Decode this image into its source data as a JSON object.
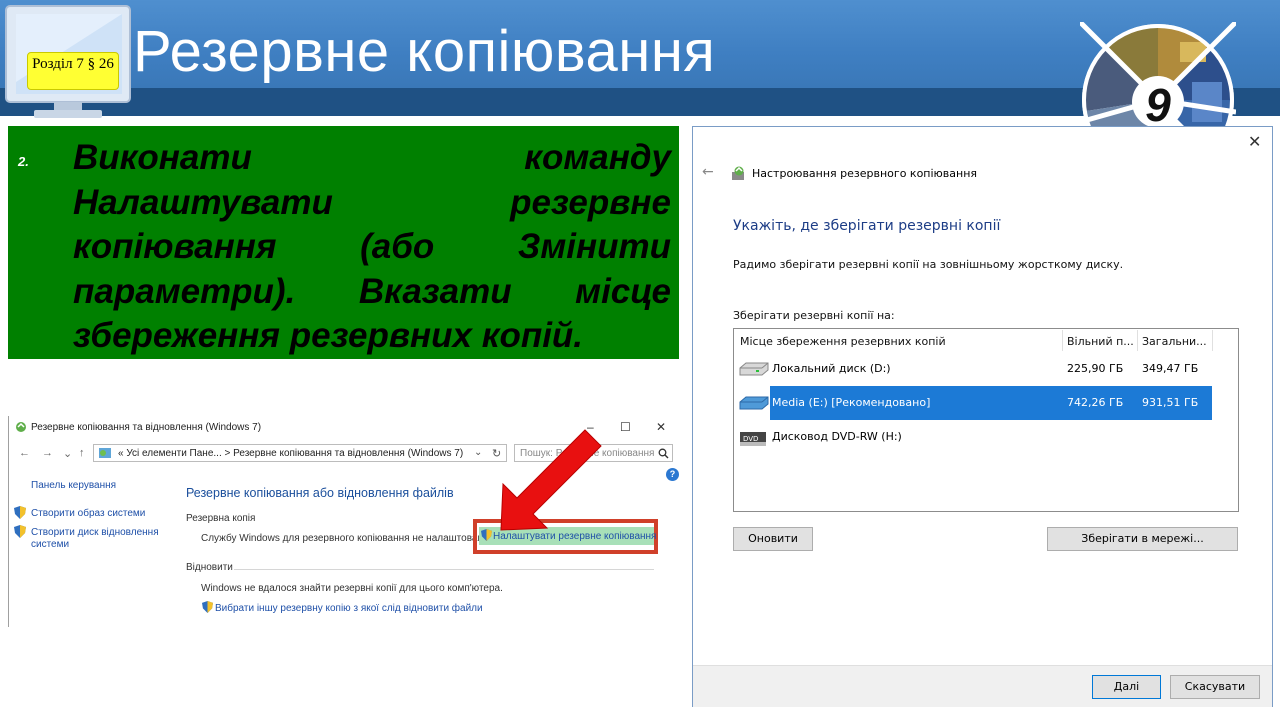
{
  "slide": {
    "badge": "Розділ 7 § 26",
    "title": "Резервне копіювання",
    "grade_number": "9",
    "step_number": "2.",
    "step_text": "Виконати команду Налаштувати резервне копіювання (або Змінити параметри). Вказати місце збереження резервних копій."
  },
  "control_panel": {
    "window_title": "Резервне копіювання та відновлення (Windows 7)",
    "window_buttons": [
      "–",
      "☐",
      "✕"
    ],
    "nav": [
      "←",
      "→",
      "⌄",
      "↑"
    ],
    "address_path": "«  Усі елементи Пане...  >  Резервне копіювання та відновлення (Windows 7)",
    "search_placeholder": "Пошук: Резервне копіювання",
    "help": "?",
    "sidebar": [
      {
        "label": "Панель керування"
      },
      {
        "label": "Створити образ системи"
      },
      {
        "label": "Створити диск відновлення системи"
      }
    ],
    "main_title": "Резервне копіювання або відновлення файлів",
    "backup_section": "Резервна копія",
    "backup_message": "Службу Windows для резервного копіювання не налаштовано.",
    "setup_link": "Налаштувати резервне копіювання",
    "restore_section": "Відновити",
    "restore_message": "Windows не вдалося знайти резервні копії для цього комп'ютера.",
    "restore_link": "Вибрати іншу резервну копію з якої слід відновити файли"
  },
  "dialog": {
    "close": "✕",
    "back": "←",
    "title": "Настроювання резервного копіювання",
    "heading": "Укажіть, де зберігати резервні копії",
    "description": "Радимо зберігати резервні копії на зовнішньому жорсткому диску.",
    "save_label": "Зберігати резервні копії на:",
    "columns": [
      "Місце збереження резервних копій",
      "Вільний п...",
      "Загальни..."
    ],
    "rows": [
      {
        "name": "Локальний диск (D:)",
        "free": "225,90 ГБ",
        "total": "349,47 ГБ",
        "selected": false,
        "icon": "hard-drive-icon"
      },
      {
        "name": "Media (E:) [Рекомендовано]",
        "free": "742,26 ГБ",
        "total": "931,51 ГБ",
        "selected": true,
        "icon": "external-drive-icon"
      },
      {
        "name": "Дисковод DVD-RW (H:)",
        "free": "",
        "total": "",
        "selected": false,
        "icon": "dvd-drive-icon"
      }
    ],
    "refresh_button": "Оновити",
    "network_button": "Зберігати в мережі...",
    "next_button": "Далі",
    "cancel_button": "Скасувати"
  },
  "colors": {
    "header_blue": "#3f7fc2",
    "header_dark": "#1f5184",
    "badge_yellow": "#ffff33",
    "green_box": "#008000",
    "arrow_red": "#e81010",
    "selection_blue": "#1c7ad6",
    "highlight_border": "#d0402a"
  }
}
